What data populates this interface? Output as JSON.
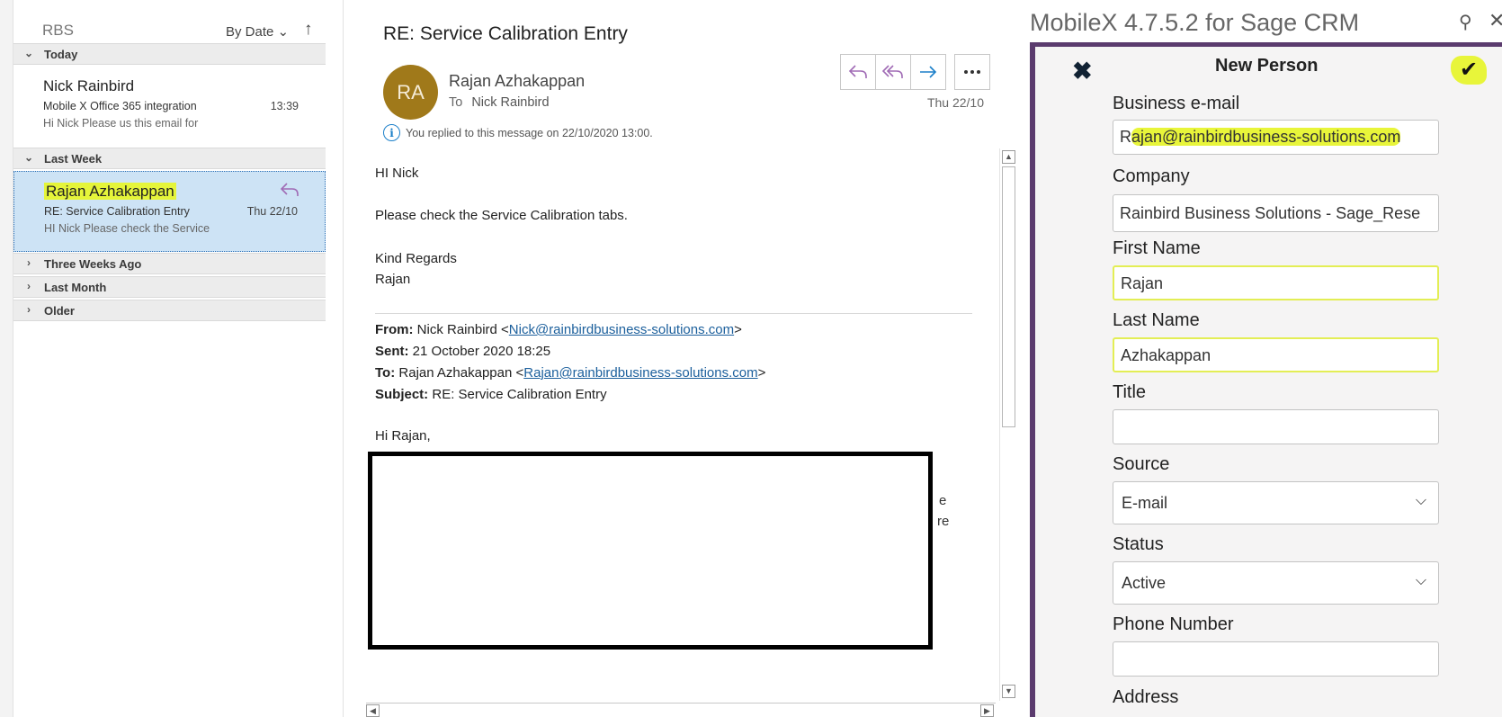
{
  "list": {
    "folder": "RBS",
    "sort_label": "By Date",
    "sort_direction_icon": "arrow-up",
    "groups": [
      {
        "label": "Today",
        "expanded": true
      },
      {
        "label": "Last Week",
        "expanded": true
      },
      {
        "label": "Three Weeks Ago",
        "expanded": false
      },
      {
        "label": "Last Month",
        "expanded": false
      },
      {
        "label": "Older",
        "expanded": false
      }
    ],
    "items": [
      {
        "sender": "Nick Rainbird",
        "subject": "Mobile X Office 365 integration",
        "preview": "Hi Nick  Please us this email for",
        "time": "13:39"
      },
      {
        "sender": "Rajan Azhakappan",
        "subject": "RE: Service Calibration Entry",
        "preview": "HI Nick  Please check the Service",
        "time": "Thu 22/10",
        "replied_icon": "reply-icon"
      }
    ]
  },
  "message": {
    "subject": "RE: Service Calibration Entry",
    "avatar_initials": "RA",
    "from": "Rajan Azhakappan",
    "to_label": "To",
    "to": "Nick Rainbird",
    "date": "Thu 22/10",
    "info": "You replied to this message on 22/10/2020 13:00.",
    "body": {
      "greeting": "HI Nick",
      "line1": "Please check the Service Calibration tabs.",
      "signoff1": "Kind Regards",
      "signoff2": "Rajan"
    },
    "quoted": {
      "from_label": "From:",
      "from_name": "Nick Rainbird <",
      "from_email": "Nick@rainbirdbusiness-solutions.com",
      "from_end": ">",
      "sent_label": "Sent:",
      "sent_value": "21 October 2020 18:25",
      "to_label": "To:",
      "to_name": "Rajan Azhakappan <",
      "to_email": "Rajan@rainbirdbusiness-solutions.com",
      "to_end": ">",
      "subject_label": "Subject:",
      "subject_value": "RE: Service Calibration Entry",
      "greeting": "Hi Rajan,",
      "peek1": "e",
      "peek2": "re"
    },
    "actions": [
      "reply-icon",
      "reply-all-icon",
      "forward-icon",
      "more-icon"
    ]
  },
  "addin": {
    "title": "MobileX 4.7.5.2 for Sage CRM",
    "form_title": "New Person",
    "fields": {
      "email_label": "Business e-mail",
      "email_value_first": "R",
      "email_value_rest": "ajan@rainbirdbusiness-solutions.com",
      "company_label": "Company",
      "company_value": "Rainbird Business Solutions - Sage_Rese",
      "first_name_label": "First Name",
      "first_name_value": "Rajan",
      "last_name_label": "Last Name",
      "last_name_value": "Azhakappan",
      "title_label": "Title",
      "title_value": "",
      "source_label": "Source",
      "source_value": "E-mail",
      "status_label": "Status",
      "status_value": "Active",
      "phone_label": "Phone Number",
      "phone_value": "",
      "address_label": "Address"
    },
    "colors": {
      "frame": "#5b3b6e",
      "highlight": "#e8f53a"
    }
  }
}
